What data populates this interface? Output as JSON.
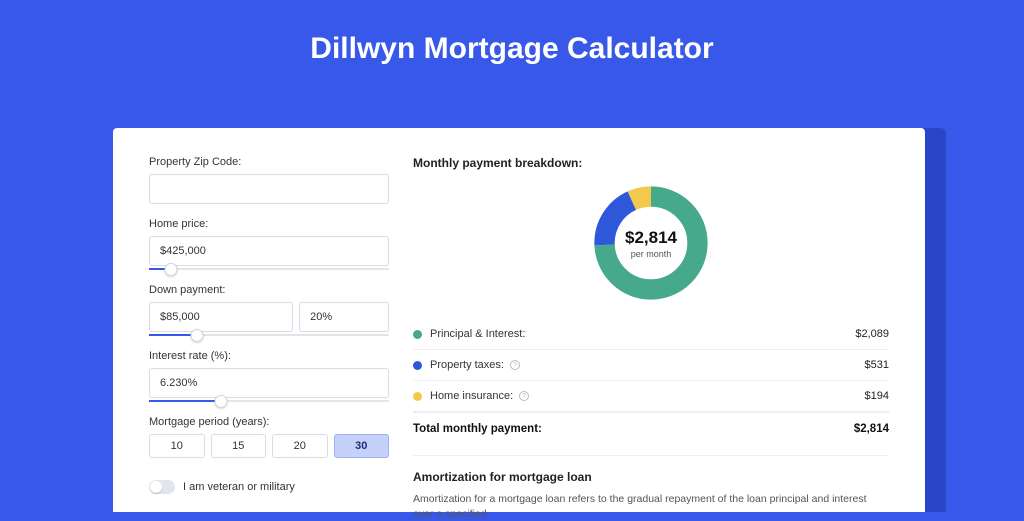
{
  "title": "Dillwyn Mortgage Calculator",
  "form": {
    "zip": {
      "label": "Property Zip Code:",
      "value": ""
    },
    "home_price": {
      "label": "Home price:",
      "value": "$425,000",
      "slider_pct": 9
    },
    "down_payment": {
      "label": "Down payment:",
      "value": "$85,000",
      "pct_value": "20%",
      "slider_pct": 20
    },
    "interest": {
      "label": "Interest rate (%):",
      "value": "6.230%",
      "slider_pct": 30
    },
    "period": {
      "label": "Mortgage period (years):",
      "options": [
        "10",
        "15",
        "20",
        "30"
      ],
      "selected": "30"
    },
    "veteran": {
      "label": "I am veteran or military",
      "checked": false
    }
  },
  "breakdown": {
    "title": "Monthly payment breakdown:",
    "center_amount": "$2,814",
    "center_sub": "per month",
    "items": [
      {
        "label": "Principal & Interest:",
        "value": "$2,089",
        "color": "#47a98c",
        "info": false
      },
      {
        "label": "Property taxes:",
        "value": "$531",
        "color": "#2f57d9",
        "info": true
      },
      {
        "label": "Home insurance:",
        "value": "$194",
        "color": "#f2c94c",
        "info": true
      }
    ],
    "total_label": "Total monthly payment:",
    "total_value": "$2,814"
  },
  "chart_data": {
    "type": "pie",
    "title": "Monthly payment breakdown",
    "series": [
      {
        "name": "Principal & Interest",
        "value": 2089,
        "color": "#47a98c"
      },
      {
        "name": "Property taxes",
        "value": 531,
        "color": "#2f57d9"
      },
      {
        "name": "Home insurance",
        "value": 194,
        "color": "#f2c94c"
      }
    ],
    "total": 2814,
    "center_label": "$2,814 per month"
  },
  "amort": {
    "title": "Amortization for mortgage loan",
    "text": "Amortization for a mortgage loan refers to the gradual repayment of the loan principal and interest over a specified"
  }
}
